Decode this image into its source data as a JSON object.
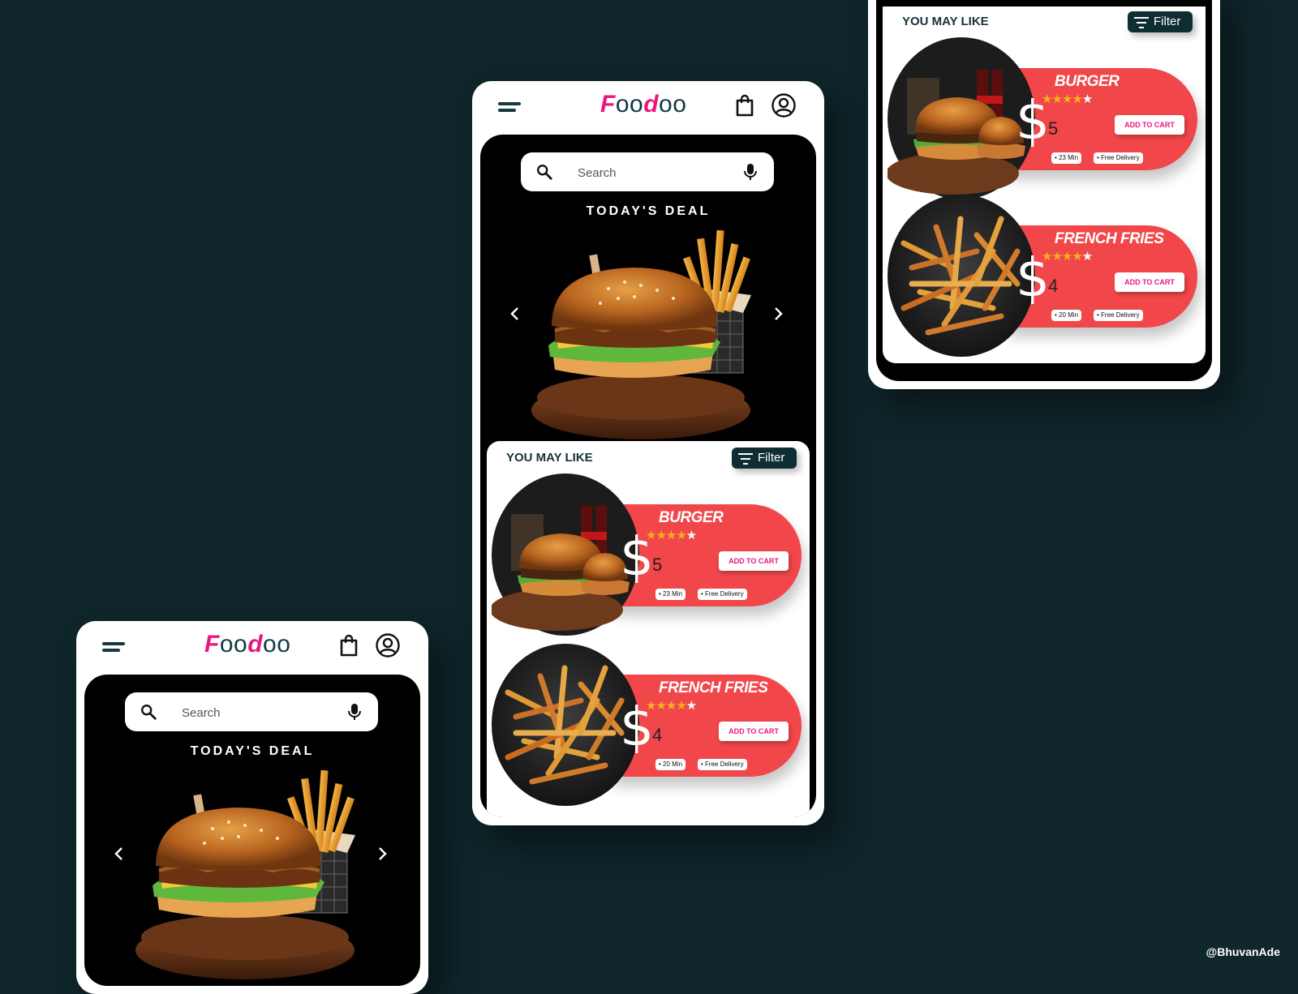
{
  "app": {
    "logo_first": "F",
    "logo_o1": "oo",
    "logo_d": "d",
    "logo_o2": "oo"
  },
  "search": {
    "placeholder": "Search"
  },
  "deal": {
    "title": "TODAY'S DEAL"
  },
  "recommendations": {
    "title": "YOU MAY LIKE",
    "filter_label": "Filter",
    "items": [
      {
        "name": "BURGER",
        "rating": 4,
        "rating_max": 5,
        "currency": "$",
        "price": "5",
        "cart_label": "ADD TO CART",
        "time": "• 23 Min",
        "delivery": "• Free Delivery"
      },
      {
        "name": "FRENCH FRIES",
        "rating": 4,
        "rating_max": 5,
        "currency": "$",
        "price": "4",
        "cart_label": "ADD TO CART",
        "time": "• 20 Min",
        "delivery": "• Free Delivery"
      }
    ]
  },
  "credit": "@BhuvanAde",
  "colors": {
    "background": "#0f262b",
    "brand_pink": "#e8177f",
    "card_red": "#f1474a",
    "dark_teal": "#0f2e33",
    "star": "#f4b31a"
  },
  "icons": {
    "menu": "hamburger-icon",
    "bag": "shopping-bag-icon",
    "profile": "user-circle-icon",
    "search": "search-icon",
    "mic": "microphone-icon",
    "prev": "chevron-left-icon",
    "next": "chevron-right-icon",
    "filter": "filter-icon"
  }
}
